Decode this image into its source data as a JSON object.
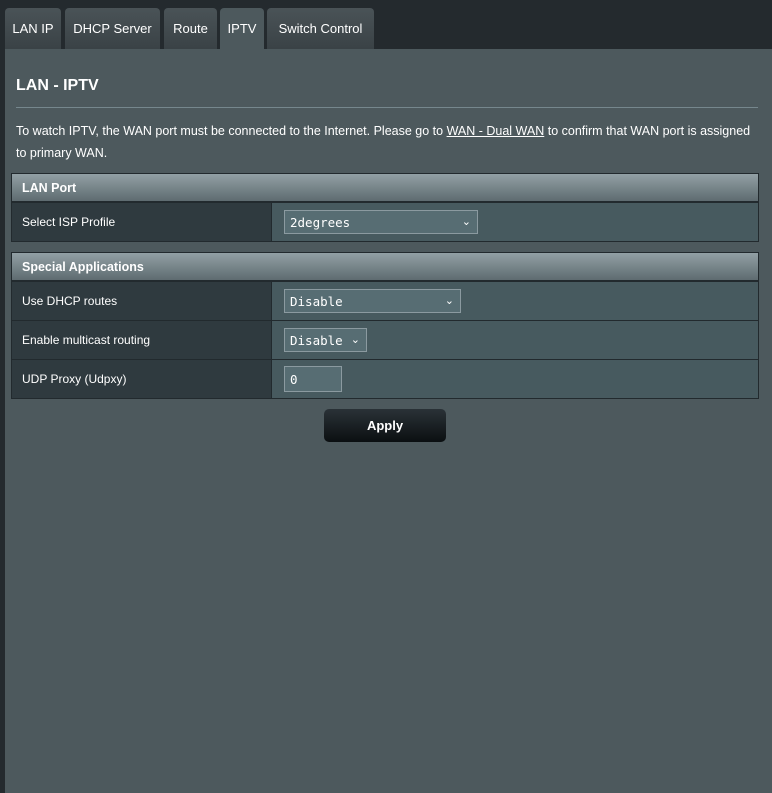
{
  "tabs": [
    {
      "label": "LAN IP"
    },
    {
      "label": "DHCP Server"
    },
    {
      "label": "Route"
    },
    {
      "label": "IPTV",
      "active": true
    },
    {
      "label": "Switch Control"
    }
  ],
  "page": {
    "title": "LAN - IPTV",
    "desc_before": "To watch IPTV, the WAN port must be connected to the Internet. Please go to ",
    "desc_link": "WAN - Dual WAN",
    "desc_after": " to confirm that WAN port is assigned to primary WAN."
  },
  "lan_port": {
    "heading": "LAN Port",
    "isp_profile_label": "Select ISP Profile",
    "isp_profile_value": "2degrees"
  },
  "special_apps": {
    "heading": "Special Applications",
    "dhcp_routes_label": "Use DHCP routes",
    "dhcp_routes_value": "Disable",
    "multicast_label": "Enable multicast routing",
    "multicast_value": "Disable",
    "udpxy_label": "UDP Proxy (Udpxy)",
    "udpxy_value": "0"
  },
  "apply_label": "Apply",
  "icons": {
    "dropdown": "chevron-down-icon"
  }
}
